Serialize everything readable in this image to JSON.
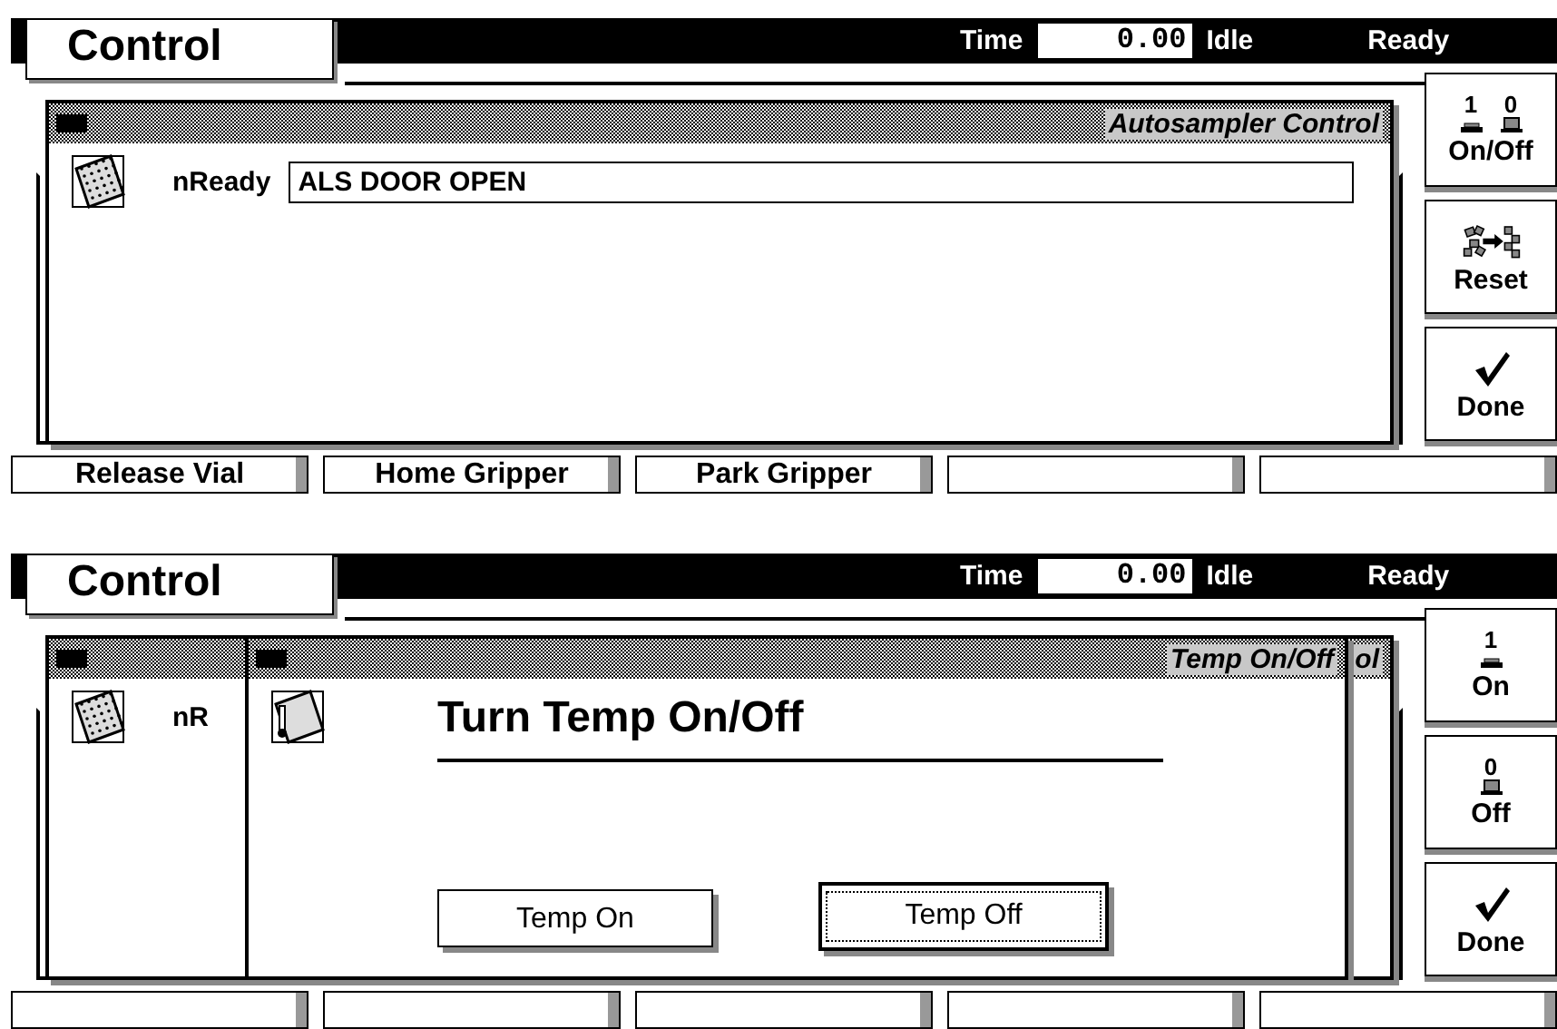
{
  "screens": [
    {
      "header": {
        "tab": "Control",
        "time_label": "Time",
        "time_value": "0.00",
        "run_state": "Idle",
        "status": "Ready"
      },
      "windows": [
        {
          "kind": "field",
          "title": "Autosampler Control",
          "label": "nReady",
          "value": "ALS DOOR OPEN"
        }
      ],
      "side_keys": [
        {
          "kind": "switch",
          "digits": [
            {
              "text": "1",
              "on": true
            },
            {
              "text": "0",
              "on": false
            }
          ],
          "label": "On/Off"
        },
        {
          "kind": "reset",
          "label": "Reset"
        },
        {
          "kind": "done",
          "label": "Done"
        }
      ],
      "softkeys": [
        {
          "kind": "key",
          "label": "Release Vial"
        },
        {
          "kind": "key",
          "label": "Home Gripper"
        },
        {
          "kind": "key",
          "label": "Park Gripper"
        },
        {
          "kind": "blank"
        },
        {
          "kind": "blank"
        }
      ]
    },
    {
      "header": {
        "tab": "Control",
        "time_label": "Time",
        "time_value": "0.00",
        "run_state": "Idle",
        "status": "Ready"
      },
      "windows": [
        {
          "kind": "choice",
          "title": "Temp On/Off",
          "heading": "Turn Temp On/Off",
          "buttons": [
            {
              "label": "Temp On",
              "selected": false
            },
            {
              "label": "Temp Off",
              "selected": true
            }
          ]
        },
        {
          "kind": "field",
          "title": "ol",
          "label": "nR"
        }
      ],
      "side_keys": [
        {
          "kind": "switch",
          "digits": [
            {
              "text": "1",
              "on": true
            }
          ],
          "label": "On"
        },
        {
          "kind": "switch",
          "digits": [
            {
              "text": "0",
              "on": false
            }
          ],
          "label": "Off"
        },
        {
          "kind": "done",
          "label": "Done"
        }
      ],
      "softkeys": [
        {
          "kind": "blank"
        },
        {
          "kind": "blank"
        },
        {
          "kind": "blank"
        },
        {
          "kind": "blank"
        },
        {
          "kind": "blank"
        }
      ]
    }
  ]
}
